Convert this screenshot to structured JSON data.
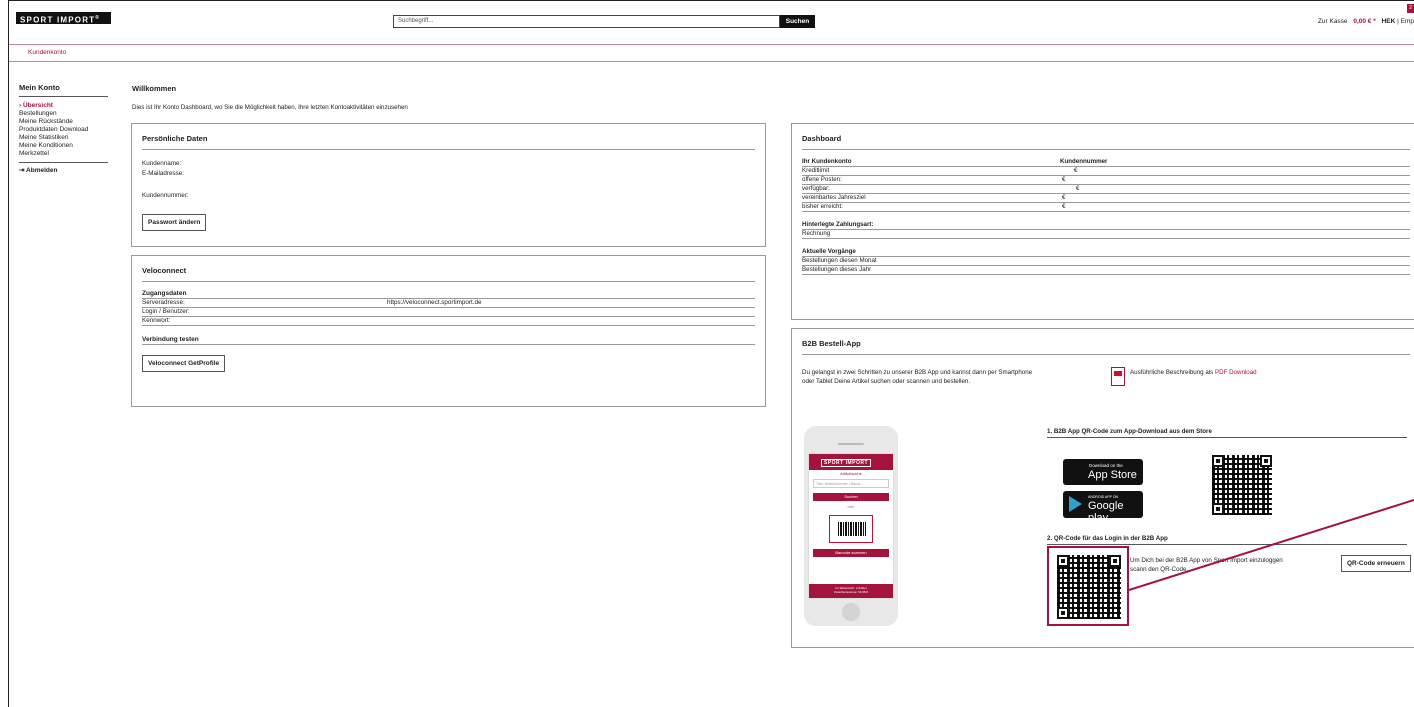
{
  "header": {
    "logo": "SPORT IMPORT",
    "logo_mark": "®",
    "search_placeholder": "Suchbegriff...",
    "search_button": "Suchen",
    "checkout_label": "Zur Kasse",
    "cart_amount": "0,00 € *",
    "currency": "HEK",
    "separator": "|",
    "cut_text": "Emp",
    "badge": "2"
  },
  "breadcrumb": "Kundenkonto",
  "sidebar": {
    "title": "Mein Konto",
    "items": [
      {
        "label": "› Übersicht"
      },
      {
        "label": "Bestellungen"
      },
      {
        "label": "Meine Rückstände"
      },
      {
        "label": "Produktdaten Download"
      },
      {
        "label": "Meine Statistiken"
      },
      {
        "label": "Meine Konditionen"
      },
      {
        "label": "Merkzettel"
      }
    ],
    "logout": "Abmelden"
  },
  "welcome": {
    "title": "Willkommen",
    "text": "Dies ist Ihr Konto Dashboard, wo Sie die Möglichkeit haben, Ihre letzten Kontoaktivitäten einzusehen"
  },
  "personal": {
    "title": "Persönliche Daten",
    "customer_name": "Kundenname:",
    "email": "E-Mailadresse:",
    "customer_number": "Kundennummer:",
    "password_button": "Passwort ändern"
  },
  "veloconnect": {
    "title": "Veloconnect",
    "access_heading": "Zugangsdaten",
    "server_label": "Serveradresse:",
    "server_value": "https://veloconnect.sportimport.de",
    "login_label": "Login / Benutzer:",
    "password_label": "Kennwort:",
    "test_heading": "Verbindung testen",
    "test_button": "Veloconnect GetProfile"
  },
  "dashboard": {
    "title": "Dashboard",
    "account_heading": "Ihr Kundenkonto",
    "number_heading": "Kundennummer",
    "rows": [
      {
        "label": "Kreditlimit",
        "value": "€"
      },
      {
        "label": "offene Posten:",
        "value": "€"
      },
      {
        "label": "verfügbar:",
        "value": "€"
      },
      {
        "label": "vereinbartes Jahresziel",
        "value": "€"
      },
      {
        "label": "bisher erreicht:",
        "value": "€"
      }
    ],
    "payment_heading": "Hinterlegte Zahlungsart:",
    "payment_value": "Rechnung",
    "current_heading": "Aktuelle Vorgänge",
    "orders_month": "Bestellungen diesen Monat",
    "orders_year": "Bestellungen dieses Jahr"
  },
  "b2b": {
    "title": "B2B Bestell-App",
    "intro_1": "Du gelangst in zwei Schritten zu unserer B2B App und kannst dann per Smartphone",
    "intro_2": "oder Tablet Deine Artikel suchen oder scannen und bestellen.",
    "pdf_text": "Ausführliche Beschreibung als ",
    "pdf_link": "PDF Download",
    "step1": "1. B2B App QR-Code zum App-Download aus dem Store",
    "appstore_small": "Download on the",
    "appstore_big": "App Store",
    "googleplay_small": "ANDROID APP ON",
    "googleplay_big": "Google play",
    "step2": "2. QR-Code für das Login in der B2B App",
    "login_text_1": "Um Dich bei der B2B App von Sport Import einzuloggen",
    "login_text_2": "scann den QR-Code.",
    "renew_button": "QR-Code erneuern",
    "phone": {
      "logo": "SPORT IMPORT",
      "subtitle": "Artikelsuche",
      "search_placeholder": "Titel / Artikelnummer / Barcd...",
      "search_button": "Suchen",
      "or": "oder",
      "scan_button": "Barcode scannen",
      "cart_line1": "Im Warenkorb: 2 Artikel",
      "cart_line2": "Zwischensumme: 53,98 €"
    }
  },
  "colors": {
    "accent": "#a4133c",
    "dark": "#111111"
  }
}
